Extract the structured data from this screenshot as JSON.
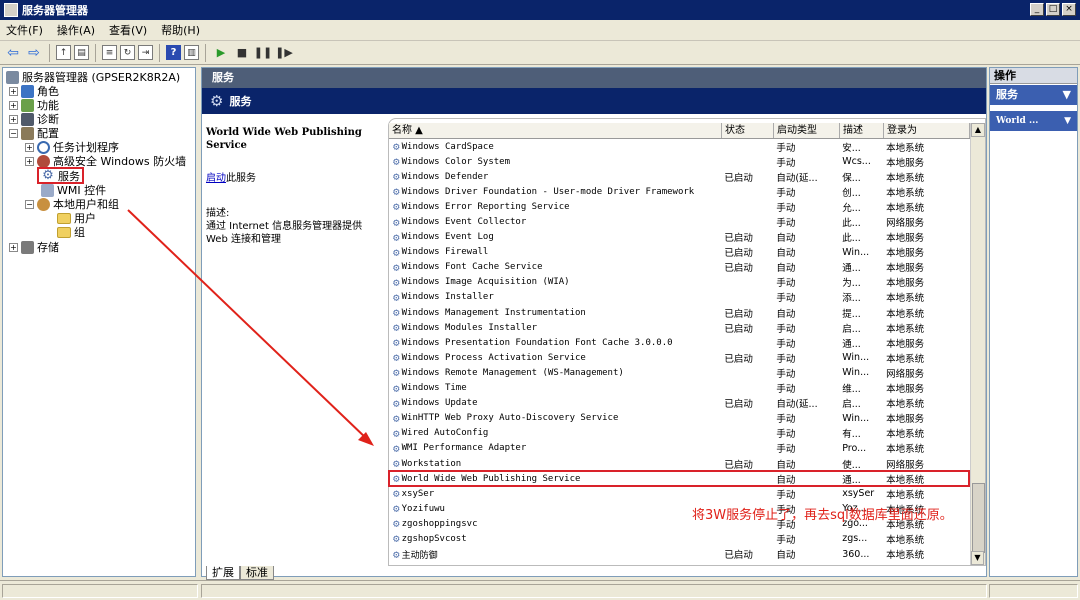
{
  "window": {
    "title": "服务器管理器",
    "controls": [
      "_",
      "□",
      "×"
    ]
  },
  "menu": [
    "文件(F)",
    "操作(A)",
    "查看(V)",
    "帮助(H)"
  ],
  "tree": {
    "root": "服务器管理器 (GPSER2K8R2A)",
    "roles": "角色",
    "features": "功能",
    "diagnostics": "诊断",
    "config": "配置",
    "task_scheduler": "任务计划程序",
    "firewall": "高级安全 Windows 防火墙",
    "services": "服务",
    "wmi": "WMI 控件",
    "local_users": "本地用户和组",
    "users": "用户",
    "groups": "组",
    "storage": "存储"
  },
  "main": {
    "header": "服务",
    "subheader": "服务",
    "selected_service": "World Wide Web Publishing Service",
    "start_link": "启动",
    "start_suffix": "此服务",
    "desc_label": "描述:",
    "desc_text": "通过 Internet 信息服务管理器提供 Web 连接和管理"
  },
  "columns": {
    "name": "名称",
    "status": "状态",
    "startup": "启动类型",
    "desc": "描述",
    "logon": "登录为"
  },
  "services": [
    {
      "name": "Windows CardSpace",
      "status": "",
      "startup": "手动",
      "desc": "安...",
      "logon": "本地系统"
    },
    {
      "name": "Windows Color System",
      "status": "",
      "startup": "手动",
      "desc": "Wcs...",
      "logon": "本地服务"
    },
    {
      "name": "Windows Defender",
      "status": "已启动",
      "startup": "自动(延...",
      "desc": "保...",
      "logon": "本地系统"
    },
    {
      "name": "Windows Driver Foundation - User-mode Driver Framework",
      "status": "",
      "startup": "手动",
      "desc": "创...",
      "logon": "本地系统"
    },
    {
      "name": "Windows Error Reporting Service",
      "status": "",
      "startup": "手动",
      "desc": "允...",
      "logon": "本地系统"
    },
    {
      "name": "Windows Event Collector",
      "status": "",
      "startup": "手动",
      "desc": "此...",
      "logon": "网络服务"
    },
    {
      "name": "Windows Event Log",
      "status": "已启动",
      "startup": "自动",
      "desc": "此...",
      "logon": "本地服务"
    },
    {
      "name": "Windows Firewall",
      "status": "已启动",
      "startup": "自动",
      "desc": "Win...",
      "logon": "本地服务"
    },
    {
      "name": "Windows Font Cache Service",
      "status": "已启动",
      "startup": "自动",
      "desc": "通...",
      "logon": "本地服务"
    },
    {
      "name": "Windows Image Acquisition (WIA)",
      "status": "",
      "startup": "手动",
      "desc": "为...",
      "logon": "本地服务"
    },
    {
      "name": "Windows Installer",
      "status": "",
      "startup": "手动",
      "desc": "添...",
      "logon": "本地系统"
    },
    {
      "name": "Windows Management Instrumentation",
      "status": "已启动",
      "startup": "自动",
      "desc": "提...",
      "logon": "本地系统"
    },
    {
      "name": "Windows Modules Installer",
      "status": "已启动",
      "startup": "手动",
      "desc": "启...",
      "logon": "本地系统"
    },
    {
      "name": "Windows Presentation Foundation Font Cache 3.0.0.0",
      "status": "",
      "startup": "手动",
      "desc": "通...",
      "logon": "本地服务"
    },
    {
      "name": "Windows Process Activation Service",
      "status": "已启动",
      "startup": "手动",
      "desc": "Win...",
      "logon": "本地系统"
    },
    {
      "name": "Windows Remote Management (WS-Management)",
      "status": "",
      "startup": "手动",
      "desc": "Win...",
      "logon": "网络服务"
    },
    {
      "name": "Windows Time",
      "status": "",
      "startup": "手动",
      "desc": "维...",
      "logon": "本地服务"
    },
    {
      "name": "Windows Update",
      "status": "已启动",
      "startup": "自动(延...",
      "desc": "启...",
      "logon": "本地系统"
    },
    {
      "name": "WinHTTP Web Proxy Auto-Discovery Service",
      "status": "",
      "startup": "手动",
      "desc": "Win...",
      "logon": "本地服务"
    },
    {
      "name": "Wired AutoConfig",
      "status": "",
      "startup": "手动",
      "desc": "有...",
      "logon": "本地系统"
    },
    {
      "name": "WMI Performance Adapter",
      "status": "",
      "startup": "手动",
      "desc": "Pro...",
      "logon": "本地系统"
    },
    {
      "name": "Workstation",
      "status": "已启动",
      "startup": "自动",
      "desc": "使...",
      "logon": "网络服务"
    },
    {
      "name": "World Wide Web Publishing Service",
      "status": "",
      "startup": "自动",
      "desc": "通...",
      "logon": "本地系统"
    },
    {
      "name": "xsySer",
      "status": "",
      "startup": "手动",
      "desc": "xsySer",
      "logon": "本地系统"
    },
    {
      "name": "Yozifuwu",
      "status": "",
      "startup": "手动",
      "desc": "Yoz...",
      "logon": "本地系统"
    },
    {
      "name": "zgoshoppingsvc",
      "status": "",
      "startup": "手动",
      "desc": "zgo...",
      "logon": "本地系统"
    },
    {
      "name": "zgshopSvcost",
      "status": "",
      "startup": "手动",
      "desc": "zgs...",
      "logon": "本地系统"
    },
    {
      "name": "主动防御",
      "status": "已启动",
      "startup": "自动",
      "desc": "360...",
      "logon": "本地系统"
    }
  ],
  "annotation": "将3W服务停止了，再去sql数据库里面还原。",
  "tabs": [
    "扩展",
    "标准"
  ],
  "actions": {
    "header": "操作",
    "group1": "服务",
    "group2": "World ..."
  }
}
